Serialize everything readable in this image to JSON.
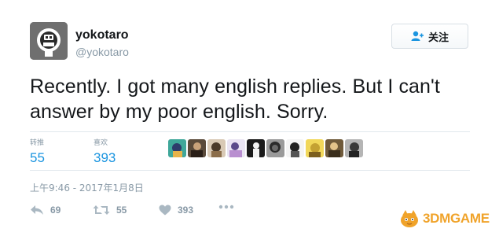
{
  "tweet": {
    "display_name": "yokotaro",
    "handle": "@yokotaro",
    "follow_label": "关注",
    "text_line1": "Recently. I got many english replies. But I can't",
    "text_line2": "answer by my poor english. Sorry.",
    "retweets_label": "转推",
    "retweets_count": "55",
    "likes_label": "喜欢",
    "likes_count": "393",
    "timestamp": "上午9:46 - 2017年1月8日",
    "actions": {
      "reply_count": "69",
      "retweet_count": "55",
      "like_count": "393"
    },
    "liker_avatars": [
      "avatar-1",
      "avatar-2",
      "avatar-3",
      "avatar-4",
      "avatar-5",
      "avatar-6",
      "avatar-7",
      "avatar-8",
      "avatar-9",
      "avatar-10",
      "avatar-11"
    ]
  },
  "watermark": {
    "text": "3DMGAME"
  },
  "colors": {
    "link_blue": "#1b95e0",
    "muted_gray": "#8899a6",
    "divider": "#e1e8ed",
    "watermark_orange": "#f0a32a"
  }
}
